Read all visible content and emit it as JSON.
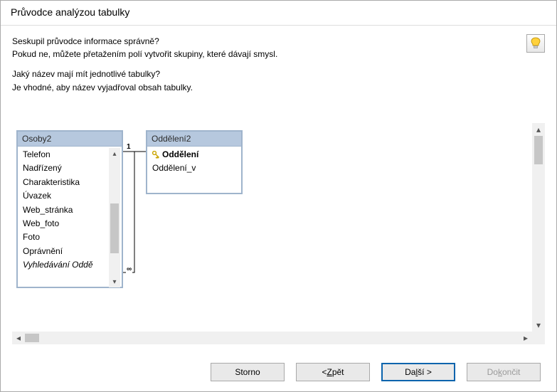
{
  "title": "Průvodce analýzou tabulky",
  "intro": {
    "q1": "Seskupil průvodce informace správně?",
    "q1b": "Pokud ne, můžete přetažením polí vytvořit skupiny, které dávají smysl.",
    "q2": "Jaký název mají mít jednotlivé tabulky?",
    "q2b": "Je vhodné, aby název vyjadřoval obsah tabulky."
  },
  "rel": {
    "left": "1",
    "right": "∞"
  },
  "tables": {
    "t1": {
      "name": "Osoby2",
      "fields": [
        {
          "label": "Telefon"
        },
        {
          "label": "Nadřízený"
        },
        {
          "label": "Charakteristika"
        },
        {
          "label": "Úvazek"
        },
        {
          "label": "Web_stránka"
        },
        {
          "label": "Web_foto"
        },
        {
          "label": "Foto"
        },
        {
          "label": "Oprávnění"
        },
        {
          "label": "Vyhledávání Oddě",
          "italic": true
        }
      ]
    },
    "t2": {
      "name": "Oddělení2",
      "fields": [
        {
          "label": "Oddělení",
          "key": true
        },
        {
          "label": "Oddělení_v"
        }
      ]
    }
  },
  "buttons": {
    "cancel": "Storno",
    "back_pre": "< ",
    "back_mn": "Z",
    "back_post": "pět",
    "next_pre": "Da",
    "next_mn": "l",
    "next_post": "ší >",
    "finish_pre": "Do",
    "finish_mn": "k",
    "finish_post": "ončit"
  }
}
